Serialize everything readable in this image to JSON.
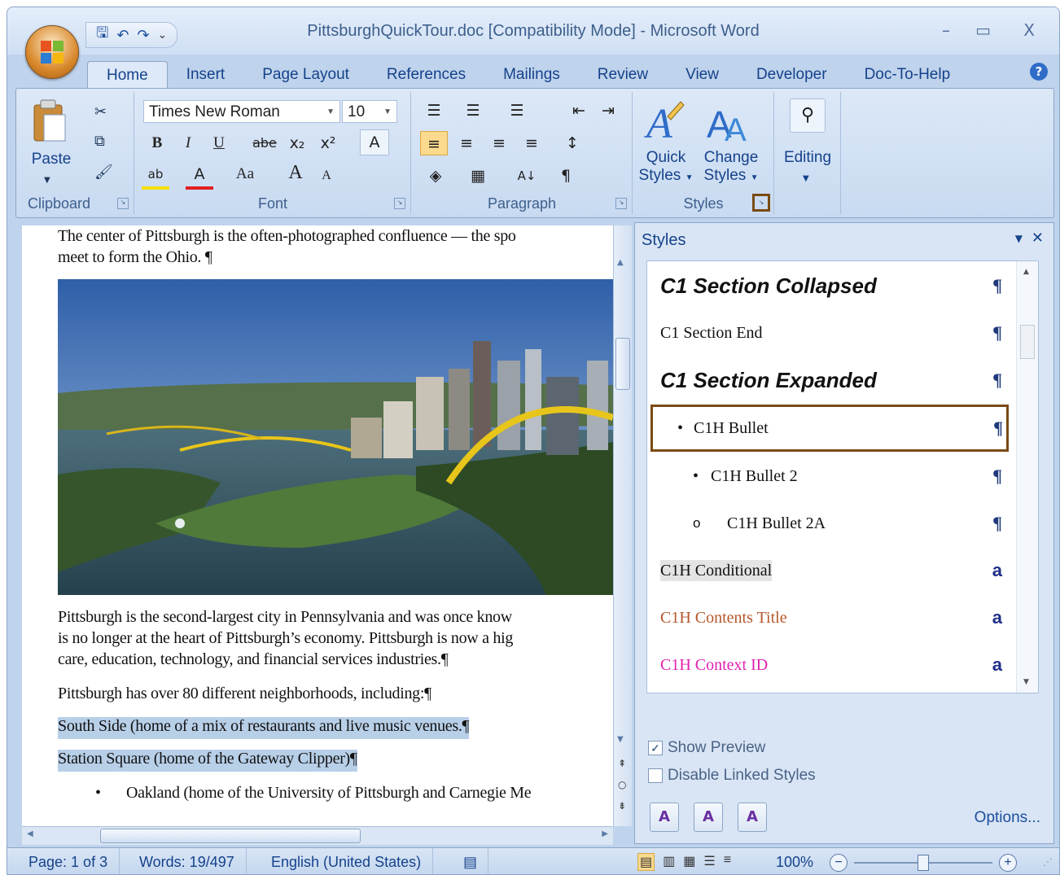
{
  "window": {
    "title": "PittsburghQuickTour.doc [Compatibility Mode] - Microsoft Word",
    "minimize": "–",
    "maximize": "▭",
    "close": "X"
  },
  "qat": {
    "save": "🖫",
    "undo": "↶",
    "redo": "↷",
    "more": "⌄"
  },
  "tabs": [
    "Home",
    "Insert",
    "Page Layout",
    "References",
    "Mailings",
    "Review",
    "View",
    "Developer",
    "Doc-To-Help"
  ],
  "help_icon": "?",
  "ribbon": {
    "clipboard": {
      "label": "Clipboard",
      "paste": "Paste"
    },
    "font": {
      "label": "Font",
      "family": "Times New Roman",
      "size": "10",
      "bold": "B",
      "italic": "I",
      "underline": "U",
      "strike": "abe",
      "subscript": "x₂",
      "superscript": "x²",
      "clear": "A",
      "highlight": "ab",
      "color": "A",
      "case": "Aa",
      "grow": "A",
      "shrink": "A"
    },
    "paragraph": {
      "label": "Paragraph"
    },
    "styles": {
      "label": "Styles",
      "quick": "Quick\nStyles",
      "quick_1": "Quick",
      "quick_2": "Styles",
      "change_1": "Change",
      "change_2": "Styles"
    },
    "editing": {
      "label": "Editing"
    }
  },
  "document": {
    "line1": "The center of Pittsburgh is the often-photographed confluence — the spo",
    "line2": "meet to form the Ohio. ¶",
    "para1": [
      "Pittsburgh is the second-largest city in Pennsylvania and was once know",
      "is no longer at the heart of Pittsburgh’s  economy. Pittsburgh is now a hig",
      "care, education, technology, and financial services industries.¶"
    ],
    "para2": "Pittsburgh has over 80 different neighborhoods, including:¶",
    "sel1": "South Side (home of a mix of restaurants and live music venues.¶",
    "sel2": "Station Square (home of the Gateway Clipper)¶",
    "bullet": "Oakland (home of the University  of Pittsburgh and Carnegie Me",
    "bullet_marker": "•"
  },
  "styles_pane": {
    "title": "Styles",
    "items": [
      {
        "name": "C1 Section Collapsed",
        "mark": "¶"
      },
      {
        "name": "C1 Section End",
        "mark": "¶"
      },
      {
        "name": "C1 Section Expanded",
        "mark": "¶"
      },
      {
        "name": "C1H Bullet",
        "mark": "¶",
        "prefix": "•"
      },
      {
        "name": "C1H Bullet 2",
        "mark": "¶",
        "prefix": "•"
      },
      {
        "name": "C1H Bullet 2A",
        "mark": "¶",
        "prefix": "o"
      },
      {
        "name": "C1H Conditional",
        "mark": "a"
      },
      {
        "name": "C1H Contents Title",
        "mark": "a"
      },
      {
        "name": "C1H Context ID",
        "mark": "a"
      }
    ],
    "show_preview": "Show Preview",
    "disable_linked": "Disable Linked Styles",
    "options": "Options..."
  },
  "status": {
    "page": "Page: 1 of 3",
    "words": "Words: 19/497",
    "language": "English (United States)",
    "zoom": "100%"
  },
  "colors": {
    "accent": "#15428b",
    "highlight_box": "#7a4a12",
    "contents_title": "#b5562a",
    "context_id": "#e020b0"
  }
}
